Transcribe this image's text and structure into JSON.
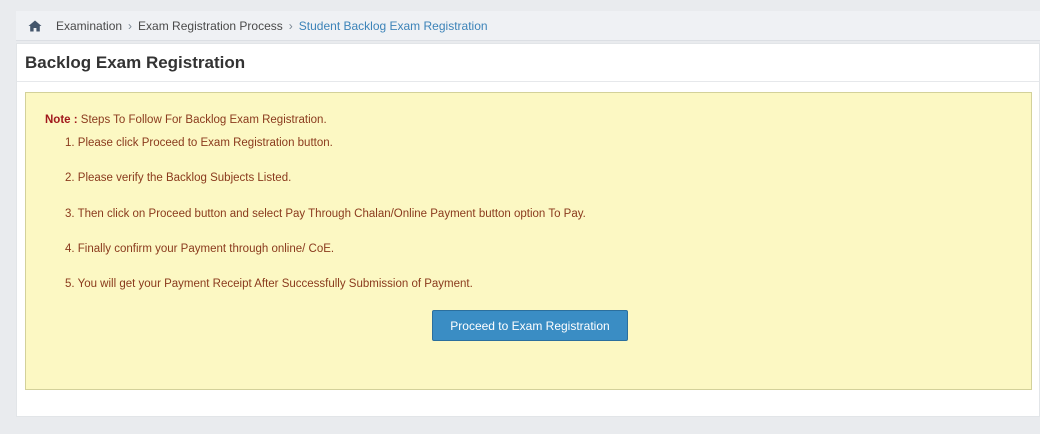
{
  "breadcrumb": {
    "items": [
      "Examination",
      "Exam Registration Process",
      "Student Backlog Exam Registration"
    ],
    "separator": "›"
  },
  "page": {
    "title": "Backlog Exam Registration"
  },
  "note": {
    "label": "Note :",
    "text": " Steps To Follow For Backlog Exam Registration.",
    "steps": [
      "1. Please click Proceed to Exam Registration button.",
      "2. Please verify the Backlog Subjects Listed.",
      "3. Then click on Proceed button and select Pay Through Chalan/Online Payment button option To Pay.",
      "4. Finally confirm your Payment through online/ CoE.",
      "5. You will get your Payment Receipt After Successfully Submission of Payment."
    ]
  },
  "actions": {
    "proceed_label": "Proceed to Exam Registration"
  },
  "colors": {
    "note_background": "#fcf8c3",
    "note_text": "#8a3a1d",
    "note_label": "#a1181c",
    "button": "#3a8dc4",
    "breadcrumb_active": "#3c83b8"
  },
  "icons": {
    "home": "home-icon"
  }
}
